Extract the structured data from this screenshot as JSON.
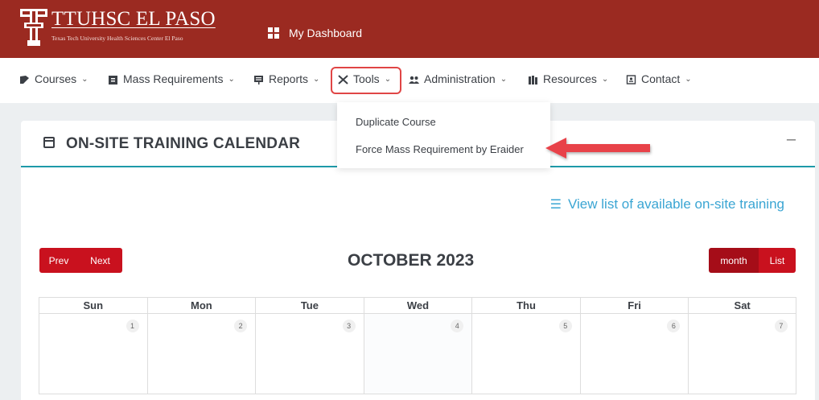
{
  "header": {
    "logo_title": "TTUHSC EL PASO",
    "logo_subtitle": "Texas Tech University Health Sciences Center El Paso",
    "dashboard_label": "My Dashboard",
    "brand_color": "#9b2a21"
  },
  "nav": {
    "items": [
      {
        "label": "Courses",
        "icon": "courses-icon"
      },
      {
        "label": "Mass Requirements",
        "icon": "clipboard-icon"
      },
      {
        "label": "Reports",
        "icon": "presentation-icon"
      },
      {
        "label": "Tools",
        "icon": "tools-icon"
      },
      {
        "label": "Administration",
        "icon": "users-icon"
      },
      {
        "label": "Resources",
        "icon": "books-icon"
      },
      {
        "label": "Contact",
        "icon": "contact-card-icon"
      }
    ]
  },
  "tools_menu": {
    "items": [
      "Duplicate Course",
      "Force Mass Requirement by Eraider"
    ]
  },
  "card": {
    "title": "ON-SITE TRAINING CALENDAR",
    "collapse_symbol": "–",
    "view_list_label": "View list of available on-site training"
  },
  "calendar": {
    "prev_label": "Prev",
    "next_label": "Next",
    "month_title": "OCTOBER 2023",
    "month_label": "month",
    "list_label": "List",
    "weekdays": [
      "Sun",
      "Mon",
      "Tue",
      "Wed",
      "Thu",
      "Fri",
      "Sat"
    ],
    "first_week": [
      "1",
      "2",
      "3",
      "4",
      "5",
      "6",
      "7"
    ]
  },
  "colors": {
    "accent_red": "#c9111e",
    "teal": "#1e9aa8",
    "link_blue": "#3aa5d3",
    "highlight_red": "#e04545"
  }
}
